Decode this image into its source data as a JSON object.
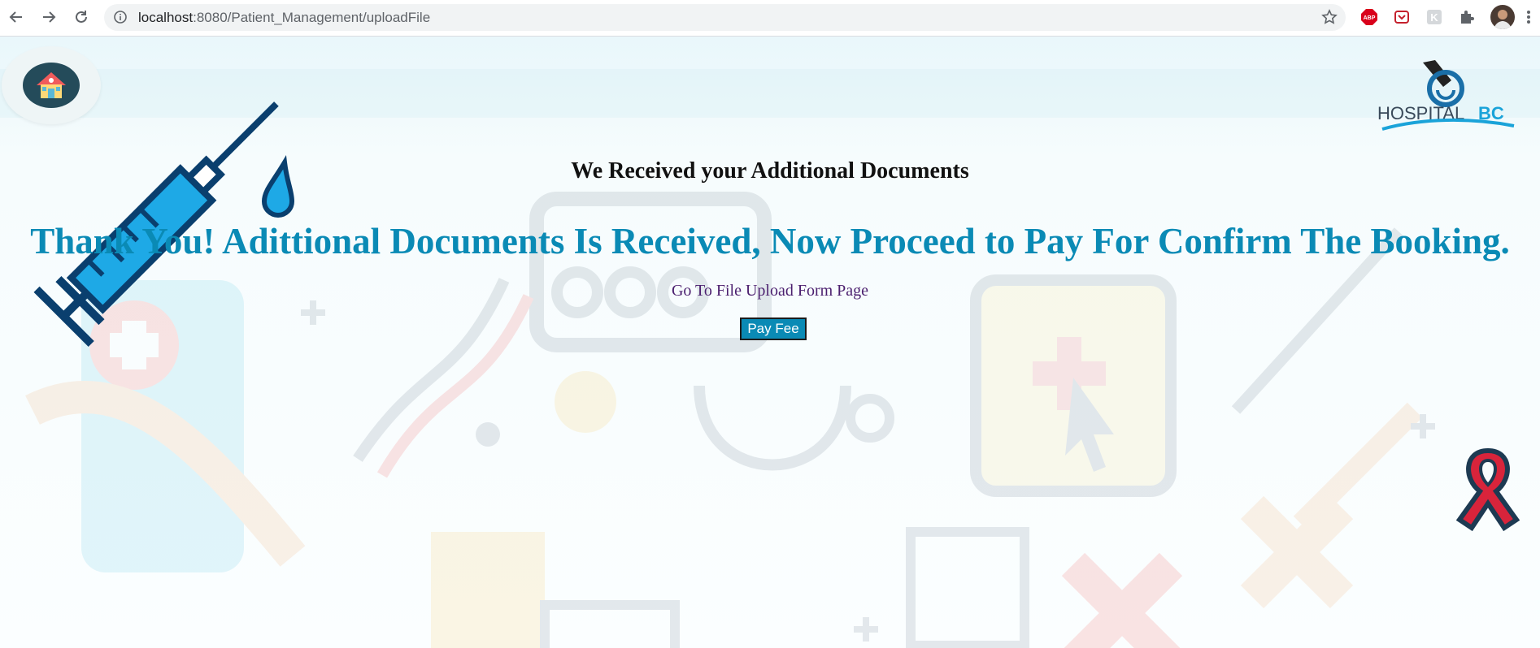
{
  "browser": {
    "url_host": "localhost",
    "url_path": ":8080/Patient_Management/uploadFile",
    "extensions": [
      "adblock-icon",
      "pocket-icon",
      "extension-k-icon",
      "puzzle-icon",
      "profile-avatar"
    ]
  },
  "page": {
    "heading": "We Received your Additional Documents",
    "message": "Thank You! Adittional Documents Is Received, Now Proceed to Pay For Confirm The Booking.",
    "link_text": "Go To File Upload Form Page",
    "pay_button": "Pay Fee",
    "logo_text_1": "HOSPITAL",
    "logo_text_2": "BC"
  },
  "colors": {
    "accent": "#0a8ab5",
    "link": "#4b1f6f"
  }
}
